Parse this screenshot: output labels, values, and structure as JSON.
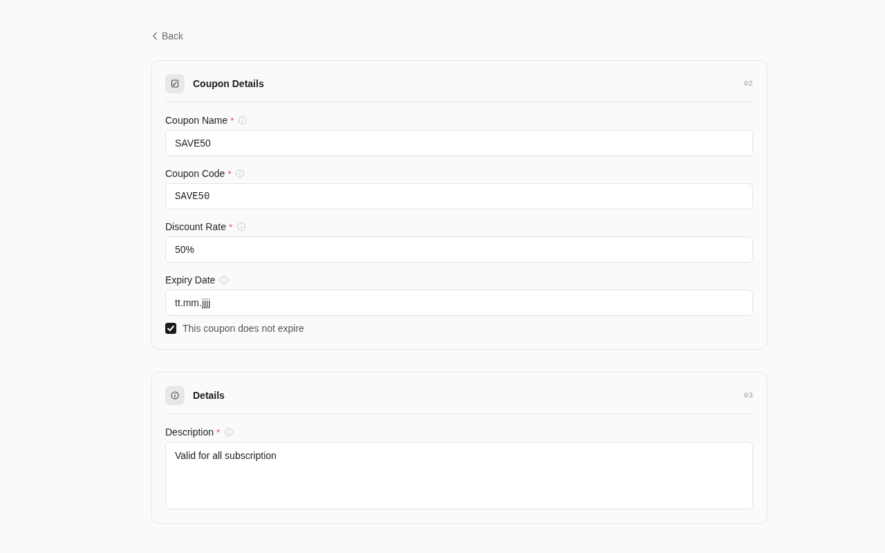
{
  "back_link": {
    "label": "Back"
  },
  "sections": [
    {
      "title": "Coupon Details",
      "number": "02",
      "fields": [
        {
          "kind": "text",
          "label": "Coupon Name",
          "required_mark": "*",
          "value": "SAVE50"
        },
        {
          "kind": "code",
          "label": "Coupon Code",
          "required_mark": "*",
          "value": "SAVE50"
        },
        {
          "kind": "text",
          "label": "Discount Rate",
          "required_mark": "*",
          "value": "50%"
        },
        {
          "kind": "date",
          "label": "Expiry Date",
          "placeholder": "tt.mm.jjjj"
        },
        {
          "kind": "checkbox",
          "label": "This coupon does not expire",
          "checked": true
        }
      ]
    },
    {
      "title": "Details",
      "number": "03",
      "fields": [
        {
          "kind": "textarea",
          "label": "Description",
          "required_mark": "*",
          "value": "Valid for all subscription"
        }
      ]
    }
  ]
}
